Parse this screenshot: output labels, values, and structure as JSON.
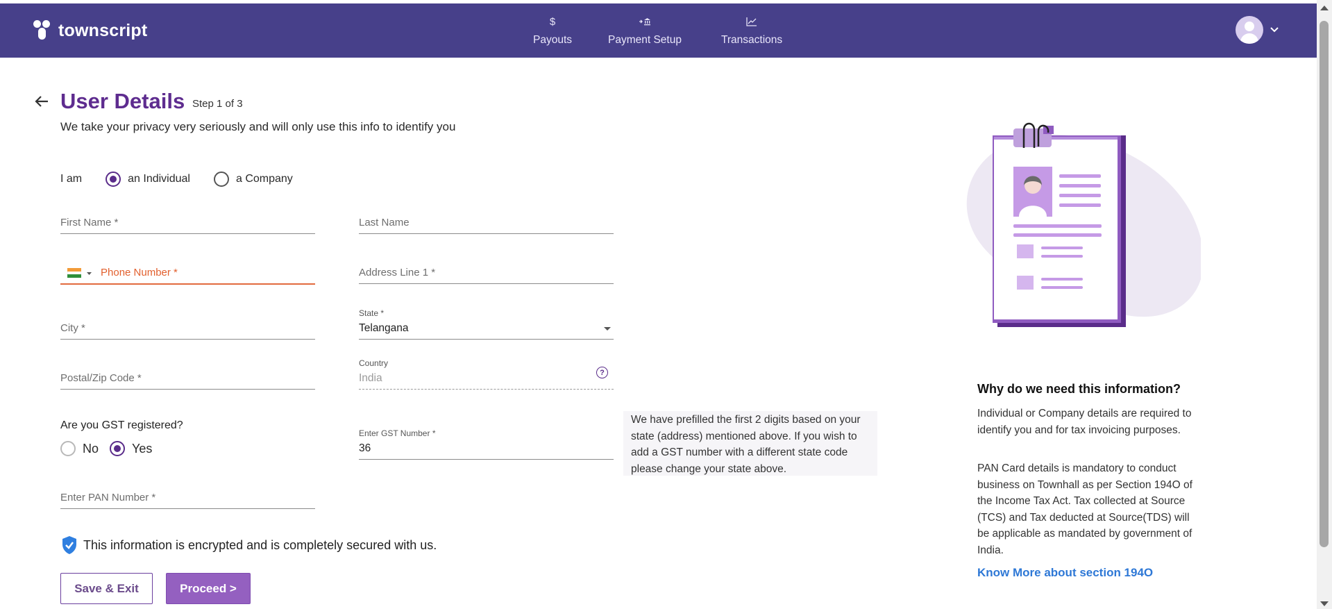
{
  "brand": {
    "name": "townscript"
  },
  "nav": [
    {
      "label": "Payouts",
      "icon": "dollar-icon"
    },
    {
      "label": "Payment Setup",
      "icon": "bank-icon"
    },
    {
      "label": "Transactions",
      "icon": "chart-line-icon"
    }
  ],
  "page": {
    "title": "User Details",
    "step": "Step 1 of 3",
    "subtitle": "We take your privacy very seriously and will only use this info to identify you"
  },
  "entity": {
    "label": "I am",
    "options": [
      "an Individual",
      "a Company"
    ],
    "selected": "an Individual"
  },
  "fields": {
    "first_name": {
      "placeholder": "First Name *"
    },
    "last_name": {
      "placeholder": "Last Name"
    },
    "phone": {
      "placeholder": "Phone Number *",
      "country_flag": "India"
    },
    "address1": {
      "placeholder": "Address Line 1 *"
    },
    "city": {
      "placeholder": "City *"
    },
    "state": {
      "label": "State *",
      "value": "Telangana"
    },
    "postal": {
      "placeholder": "Postal/Zip Code *"
    },
    "country": {
      "label": "Country",
      "value": "India"
    },
    "gst_number": {
      "label": "Enter GST Number *",
      "value": "36"
    },
    "pan": {
      "placeholder": "Enter PAN Number *"
    }
  },
  "gst": {
    "question": "Are you GST registered?",
    "options": [
      "No",
      "Yes"
    ],
    "selected": "Yes",
    "note": "We have prefilled the first 2 digits based on your state (address) mentioned above. If you wish to add a GST number with a different state code please change your state above."
  },
  "secure_text": "This information is encrypted and is completely secured with us.",
  "buttons": {
    "save_exit": "Save & Exit",
    "proceed": "Proceed >"
  },
  "info": {
    "title": "Why do we need this information?",
    "p1": "Individual or Company details are required to identify you and for tax invoicing purposes.",
    "p2": "PAN Card details is mandatory to conduct business on Townhall as per Section 194O of the Income Tax Act. Tax collected at Source (TCS) and Tax deducted at Source(TDS) will be applicable as mandated by government of India.",
    "link": "Know More about section 194O"
  },
  "colors": {
    "header": "#47408a",
    "accent": "#5e2c8f",
    "primary_button": "#9460c0",
    "error": "#e26a3d",
    "link": "#2e78d6"
  }
}
